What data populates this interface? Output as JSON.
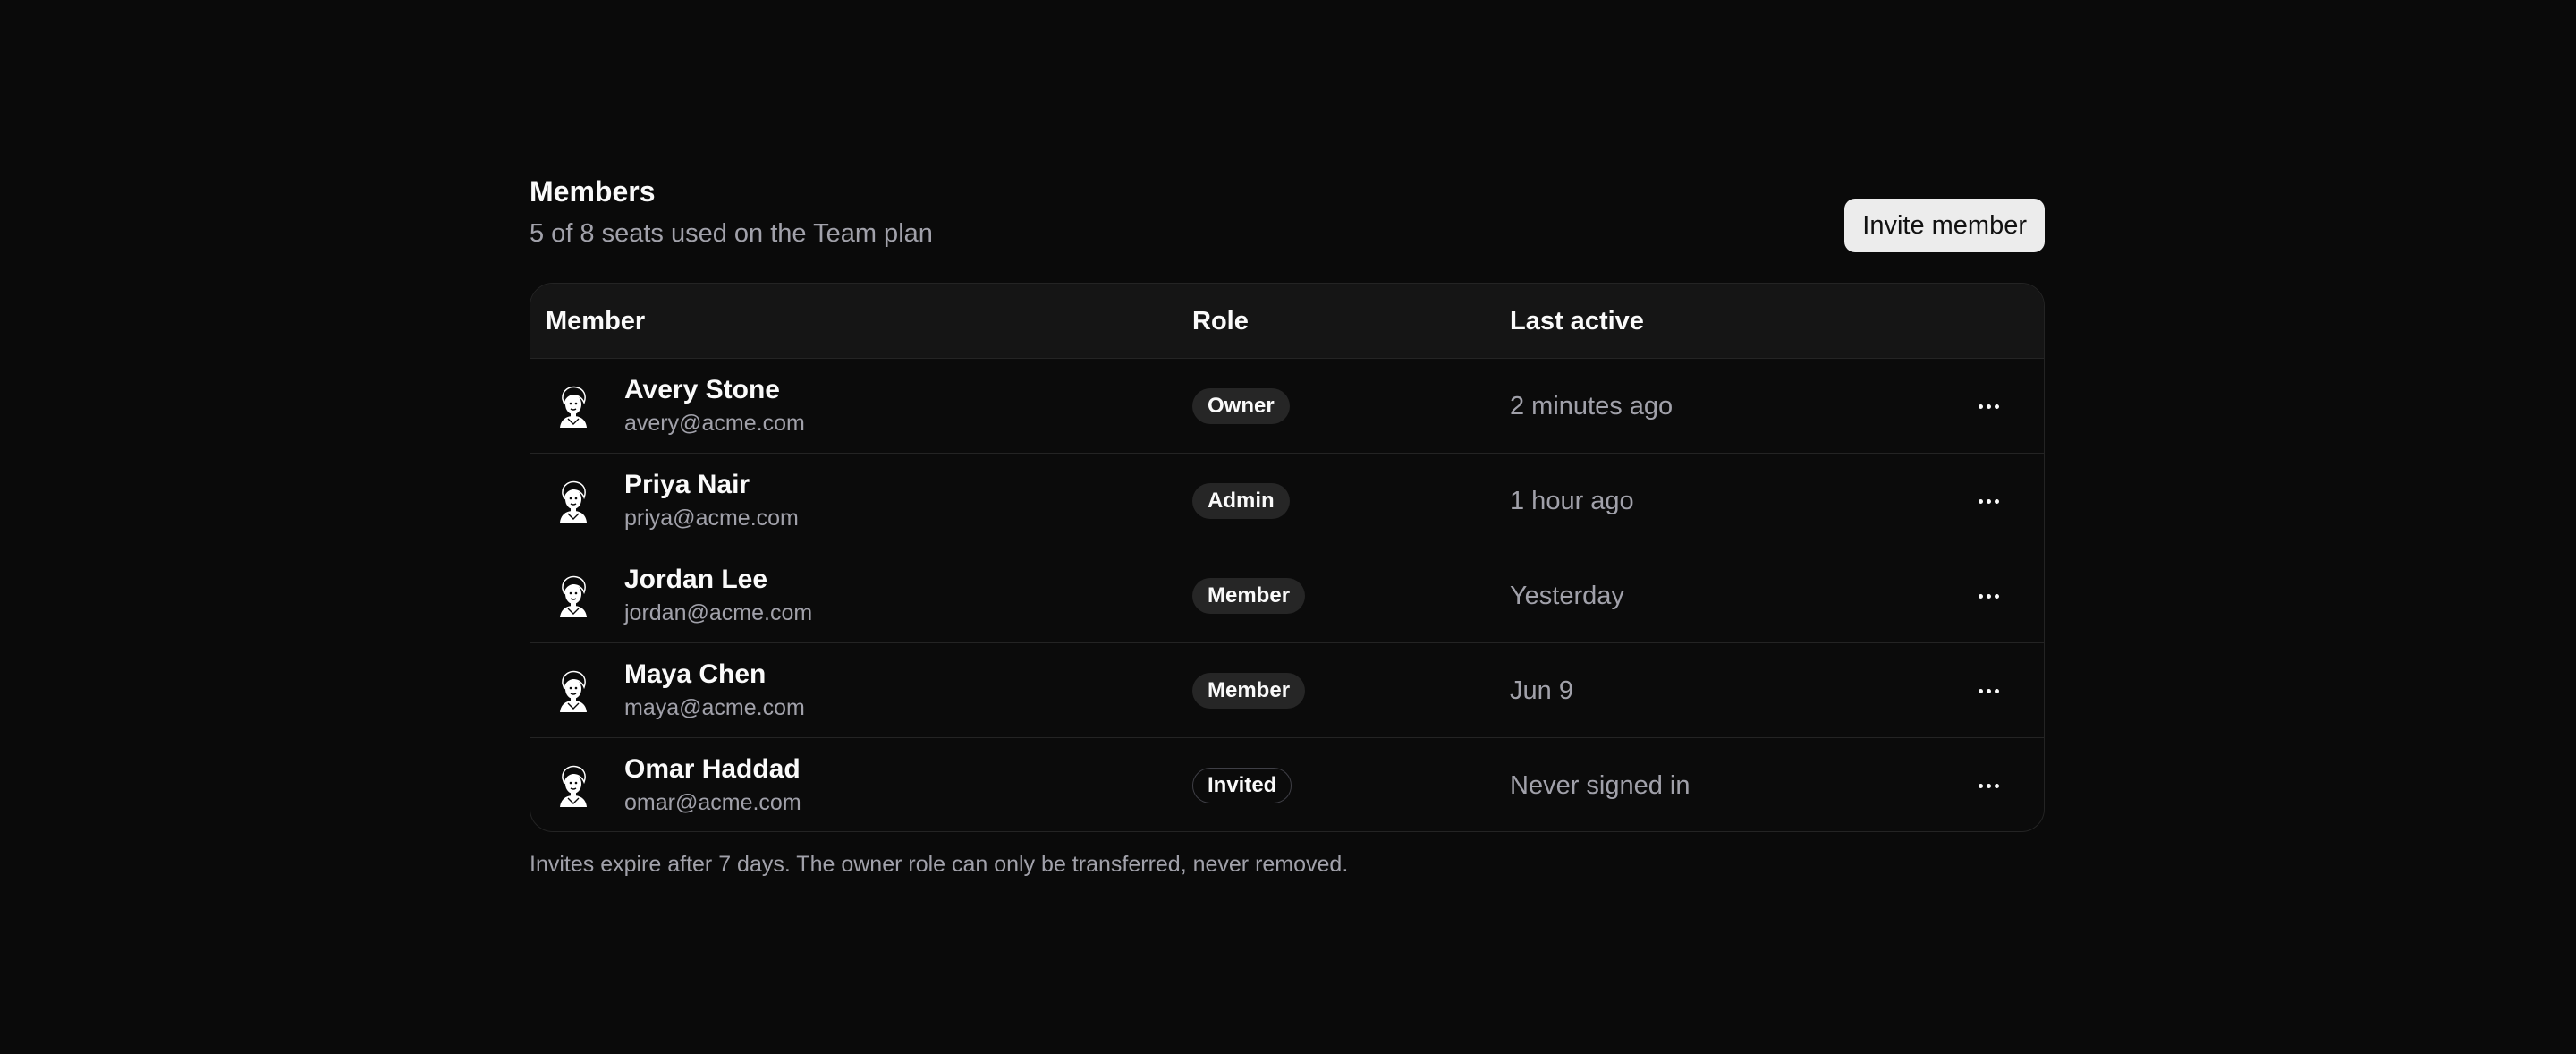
{
  "header": {
    "title": "Members",
    "subtitle": "5 of 8 seats used on the Team plan",
    "invite_label": "Invite member"
  },
  "table": {
    "columns": {
      "member": "Member",
      "role": "Role",
      "last_active": "Last active"
    },
    "rows": [
      {
        "name": "Avery Stone",
        "email": "avery@acme.com",
        "role": "Owner",
        "last_active": "2 minutes ago",
        "avatar_icon": "person-illustration-icon"
      },
      {
        "name": "Priya Nair",
        "email": "priya@acme.com",
        "role": "Admin",
        "last_active": "1 hour ago",
        "avatar_icon": "person-illustration-icon"
      },
      {
        "name": "Jordan Lee",
        "email": "jordan@acme.com",
        "role": "Member",
        "last_active": "Yesterday",
        "avatar_icon": "person-illustration-icon"
      },
      {
        "name": "Maya Chen",
        "email": "maya@acme.com",
        "role": "Member",
        "last_active": "Jun 9",
        "avatar_icon": "person-illustration-icon"
      },
      {
        "name": "Omar Haddad",
        "email": "omar@acme.com",
        "role": "Invited",
        "last_active": "Never signed in",
        "avatar_icon": "person-illustration-icon"
      }
    ]
  },
  "footnote": "Invites expire after 7 days. The owner role can only be transferred, never removed.",
  "colors": {
    "background": "#0a0a0a",
    "header_row": "#151515",
    "border": "#242424",
    "text_primary": "#fafafa",
    "text_muted": "#a1a1aa",
    "badge_bg": "#262626",
    "button_bg": "#ececec"
  }
}
